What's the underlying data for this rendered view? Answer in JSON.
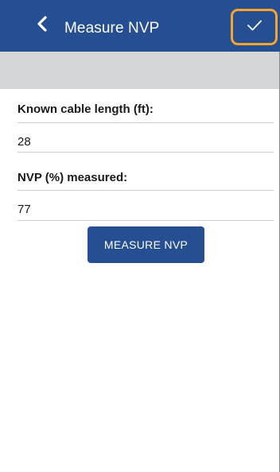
{
  "header": {
    "title": "Measure NVP",
    "back_icon": "chevron-left-icon",
    "confirm_icon": "check-icon",
    "accent": "#254e93",
    "highlight": "#f4a52a"
  },
  "form": {
    "cable_length": {
      "label": "Known cable length (ft):",
      "value": "28"
    },
    "nvp": {
      "label": "NVP (%) measured:",
      "value": "77"
    },
    "measure_button": "MEASURE NVP"
  }
}
